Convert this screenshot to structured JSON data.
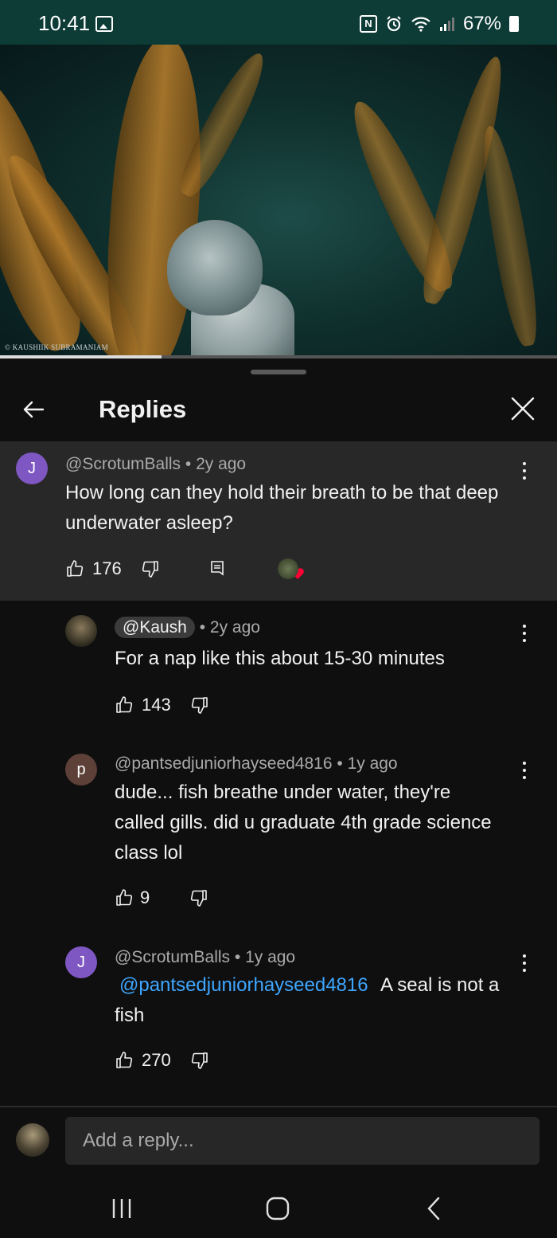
{
  "status": {
    "time": "10:41",
    "battery": "67%",
    "nfc": "N"
  },
  "video": {
    "watermark": "© KAUSHIIK SUBRAMANIAM",
    "progress": 0.29
  },
  "header": {
    "title": "Replies"
  },
  "parent": {
    "avatar_letter": "J",
    "avatar_color": "#7e57c2",
    "author": "@ScrotumBalls",
    "age": "2y ago",
    "text": "How long can they hold their breath to be that deep underwater asleep?",
    "likes": "176"
  },
  "replies": [
    {
      "author": "@Kaush",
      "age": "2y ago",
      "text": "For a nap like this about 15-30 minutes",
      "likes": "143"
    },
    {
      "avatar_letter": "p",
      "avatar_color": "#5d4037",
      "author": "@pantsedjuniorhayseed4816",
      "age": "1y ago",
      "text": "dude... fish breathe under water, they're called gills. did u graduate 4th grade science class lol",
      "likes": "9"
    },
    {
      "avatar_letter": "J",
      "avatar_color": "#7e57c2",
      "author": "@ScrotumBalls",
      "age": "1y ago",
      "mention": "@pantsedjuniorhayseed4816",
      "text": " A seal is not a fish",
      "likes": "270"
    }
  ],
  "compose": {
    "placeholder": "Add a reply..."
  },
  "colors": {
    "accent": "#3ea6ff",
    "status_bar": "#0d3b36",
    "background": "#0f0f0f",
    "parent_bg": "#282828"
  }
}
